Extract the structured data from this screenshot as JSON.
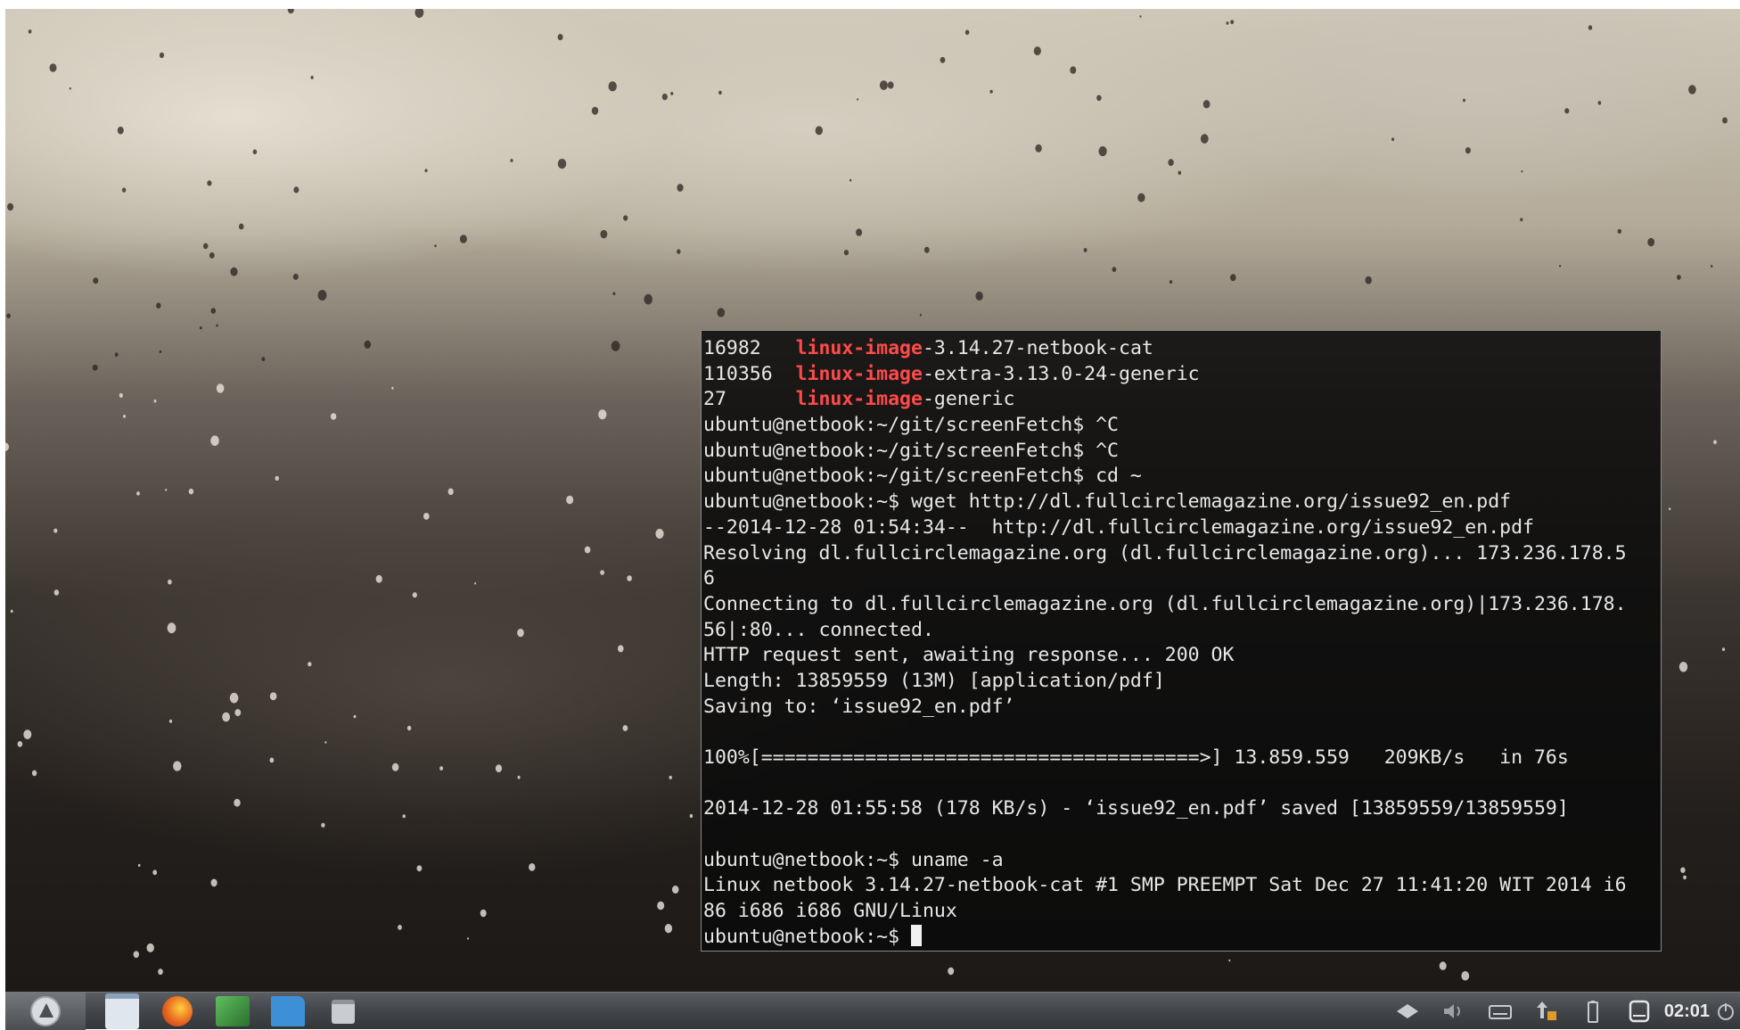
{
  "terminal": {
    "lines": [
      {
        "pre": "16982   ",
        "hl": "linux-image",
        "post": "-3.14.27-netbook-cat"
      },
      {
        "pre": "110356  ",
        "hl": "linux-image",
        "post": "-extra-3.13.0-24-generic"
      },
      {
        "pre": "27      ",
        "hl": "linux-image",
        "post": "-generic"
      },
      {
        "text": "ubuntu@netbook:~/git/screenFetch$ ^C"
      },
      {
        "text": "ubuntu@netbook:~/git/screenFetch$ ^C"
      },
      {
        "text": "ubuntu@netbook:~/git/screenFetch$ cd ~"
      },
      {
        "text": "ubuntu@netbook:~$ wget http://dl.fullcirclemagazine.org/issue92_en.pdf"
      },
      {
        "text": "--2014-12-28 01:54:34--  http://dl.fullcirclemagazine.org/issue92_en.pdf"
      },
      {
        "text": "Resolving dl.fullcirclemagazine.org (dl.fullcirclemagazine.org)... 173.236.178.5"
      },
      {
        "text": "6"
      },
      {
        "text": "Connecting to dl.fullcirclemagazine.org (dl.fullcirclemagazine.org)|173.236.178."
      },
      {
        "text": "56|:80... connected."
      },
      {
        "text": "HTTP request sent, awaiting response... 200 OK"
      },
      {
        "text": "Length: 13859559 (13M) [application/pdf]"
      },
      {
        "text": "Saving to: ‘issue92_en.pdf’"
      },
      {
        "text": ""
      },
      {
        "text": "100%[======================================>] 13.859.559   209KB/s   in 76s"
      },
      {
        "text": ""
      },
      {
        "text": "2014-12-28 01:55:58 (178 KB/s) - ‘issue92_en.pdf’ saved [13859559/13859559]"
      },
      {
        "text": ""
      },
      {
        "text": "ubuntu@netbook:~$ uname -a"
      },
      {
        "text": "Linux netbook 3.14.27-netbook-cat #1 SMP PREEMPT Sat Dec 27 11:41:20 WIT 2014 i6"
      },
      {
        "text": "86 i686 i686 GNU/Linux"
      },
      {
        "text": "ubuntu@netbook:~$ ",
        "cursor": true
      }
    ]
  },
  "taskbar": {
    "start_icon": "lubuntu-logo-icon",
    "apps": [
      {
        "name": "file-manager-window-icon",
        "color": "#dfe6ee"
      },
      {
        "name": "firefox-icon",
        "color": "#e8661f"
      },
      {
        "name": "terminal-icon",
        "color": "#3b8a3e"
      },
      {
        "name": "folder-icon",
        "color": "#3d8fd6"
      },
      {
        "name": "window-icon",
        "color": "#c9ccd0"
      }
    ],
    "tray_icons": [
      "network-icon",
      "volume-icon",
      "keyboard-icon",
      "update-icon",
      "battery-icon",
      "device-icon"
    ],
    "clock": "02:01",
    "logout_icon": "power-icon"
  }
}
